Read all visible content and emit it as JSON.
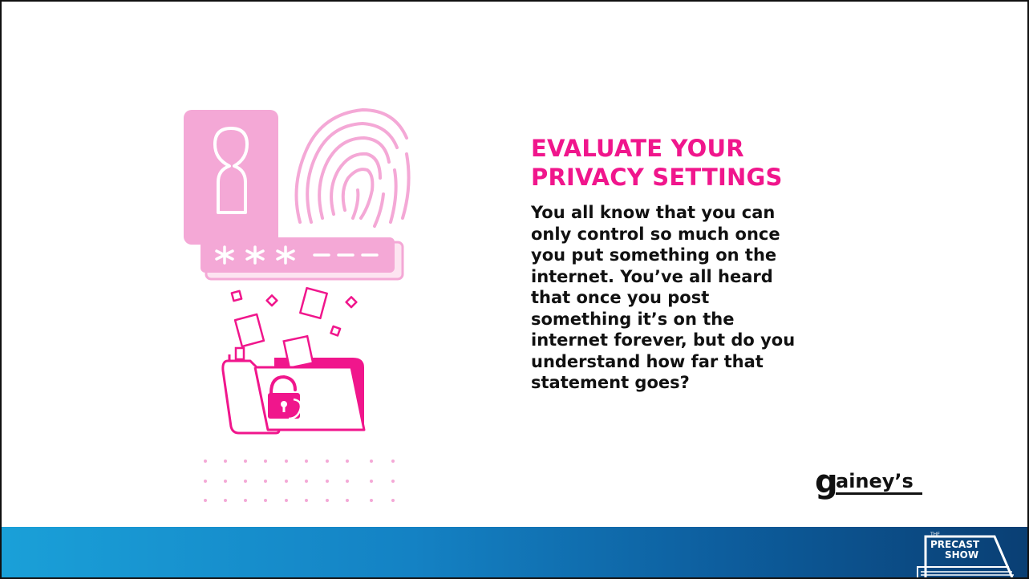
{
  "slide": {
    "title_lines": [
      "EVALUATE YOUR",
      "PRIVACY SETTINGS"
    ],
    "body_lines": [
      "You all know that you can",
      "only control so much once",
      "you put something on the",
      "internet. You’ve all heard",
      "that once you post",
      "something it’s on the",
      "internet forever, but do you",
      "understand how far that",
      "statement goes?"
    ]
  },
  "illustration": {
    "password_mask": "*** ---",
    "icons": [
      "user-profile-card-icon",
      "fingerprint-icon",
      "password-field-icon",
      "floating-documents-icon",
      "unlocked-folder-icon",
      "dot-grid-decoration"
    ]
  },
  "branding": {
    "logo_text": "gainey's",
    "badge_small": "THE",
    "badge_line1": "PRECAST",
    "badge_line2": "SHOW"
  },
  "colors": {
    "accent_pink": "#f0168c",
    "light_pink": "#f4a8d6",
    "text_dark": "#111111",
    "footer_blue_start": "#1aa0d8",
    "footer_blue_end": "#0a3f74"
  }
}
